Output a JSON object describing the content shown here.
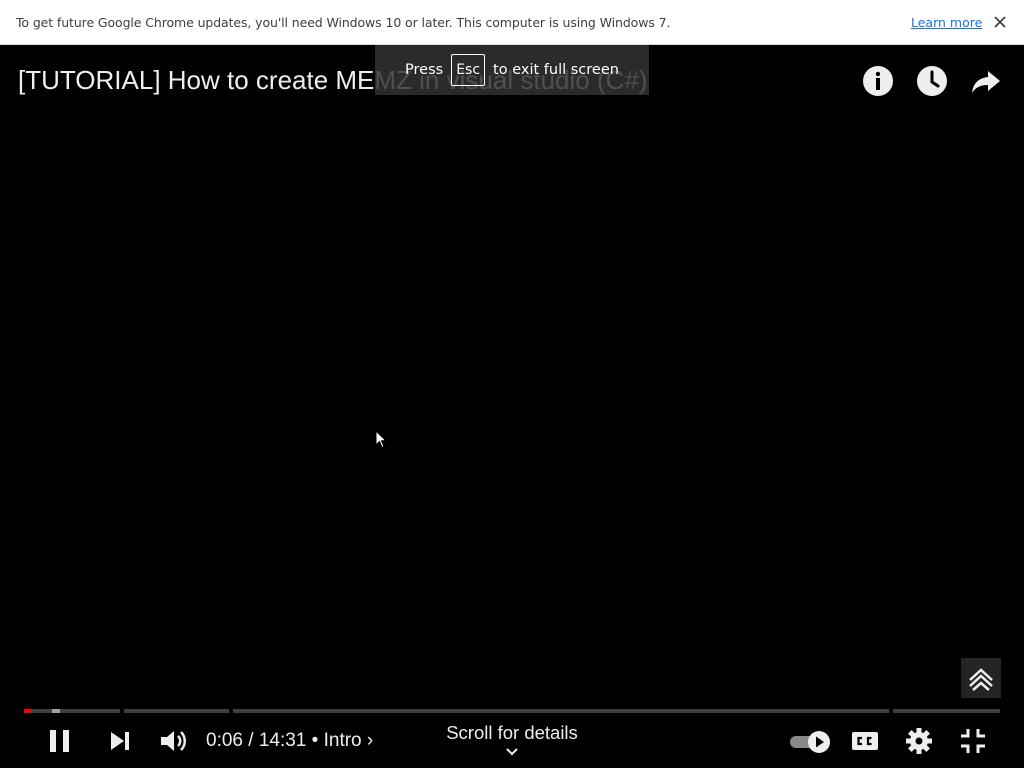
{
  "infobar": {
    "message": "To get future Google Chrome updates, you'll need Windows 10 or later. This computer is using Windows 7.",
    "link": "Learn more"
  },
  "fullscreen_hint": {
    "prefix": "Press",
    "key": "Esc",
    "suffix": "to exit full screen"
  },
  "video": {
    "title": "[TUTORIAL] How to create MEMZ in visual studio (C#)",
    "progress_fraction": 0.007
  },
  "controls": {
    "current_time": "0:06",
    "separator": "/",
    "duration": "14:31",
    "bullet": "•",
    "chapter": "Intro",
    "chapter_chevron": "›",
    "scroll_label": "Scroll for details"
  },
  "colors": {
    "progress_played": "#ff0000",
    "link": "#1a73e8"
  }
}
